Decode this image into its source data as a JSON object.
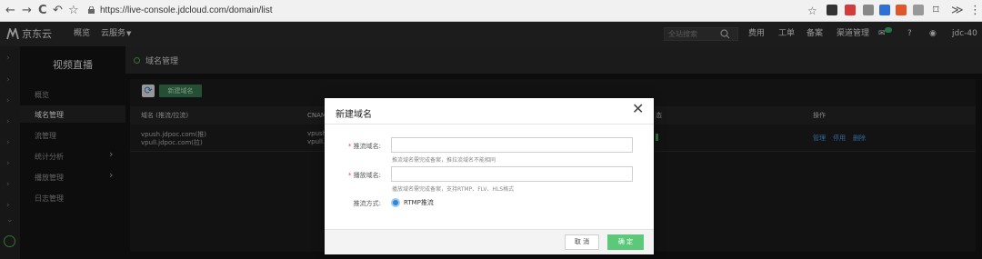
{
  "browser": {
    "back": "←",
    "forward": "→",
    "reload": "C",
    "undo": "↶",
    "star": "☆",
    "url": "https://live-console.jdcloud.com/domain/list",
    "ext_colors": [
      "#333333",
      "#d43b3b",
      "#888888",
      "#2f6fd6",
      "#e0572c",
      "#999999"
    ],
    "crop": "⌑",
    "more": "≫",
    "menu": "⋮"
  },
  "topnav": {
    "brand": "京东云",
    "overview": "概览",
    "services": "云服务",
    "search_placeholder": "全站搜索",
    "fee": "费用",
    "ticket": "工单",
    "record": "备案",
    "channel": "渠道管理",
    "user": "jdc-40"
  },
  "sidebar": {
    "title": "视频直播",
    "items": [
      {
        "label": "概览"
      },
      {
        "label": "域名管理"
      },
      {
        "label": "流管理"
      },
      {
        "label": "统计分析"
      },
      {
        "label": "播放管理"
      },
      {
        "label": "日志管理"
      }
    ]
  },
  "main": {
    "page_title": "域名管理",
    "new_domain_button": "新建域名",
    "table": {
      "headers": [
        "域名 (推流/拉流)",
        "CNAME",
        "态",
        "操作"
      ],
      "row": {
        "domain_push": "vpush.jdpoc.com(推)",
        "domain_pull": "vpull.jdpoc.com(拉)",
        "cname_push": "vpush",
        "cname_pull": "vpull.j",
        "actions": [
          "管理",
          "停用",
          "删除"
        ]
      }
    }
  },
  "modal": {
    "title": "新建域名",
    "push_label": "推流域名:",
    "push_hint": "推流域名需完成备案，推拉流域名不能相同",
    "play_label": "播放域名:",
    "play_hint": "播放域名需完成备案，支持RTMP、FLV、HLS格式",
    "method_label": "推流方式:",
    "method_value": "RTMP推流",
    "cancel": "取 消",
    "confirm": "确 定"
  }
}
